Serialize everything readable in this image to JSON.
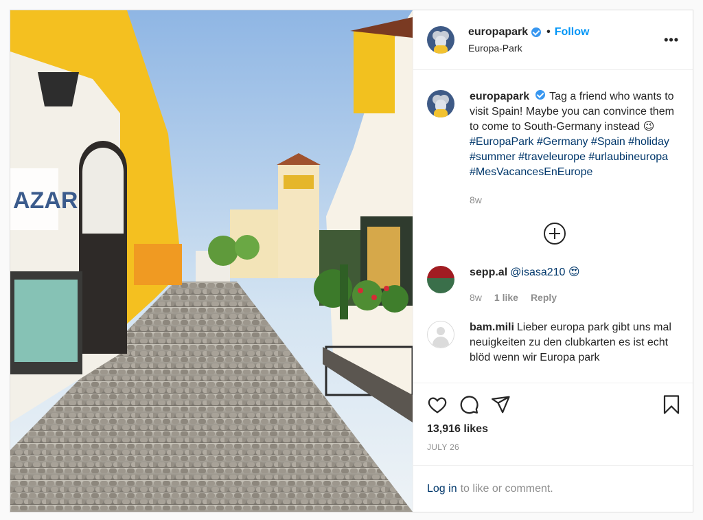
{
  "post": {
    "username": "europapark",
    "follow_label": "Follow",
    "location": "Europa-Park",
    "more_label": "•••",
    "image": {
      "shop_sign": "AZAR"
    },
    "caption": {
      "username": "europapark",
      "text": "Tag a friend who wants to visit Spain! Maybe you can convince them to come to South-Germany instead 😉 ",
      "hashtags": "#EuropaPark #Germany #Spain #holiday #summer #traveleurope #urlaubineuropa #MesVacancesEnEurope",
      "time": "8w"
    },
    "comments": [
      {
        "username": "sepp.al",
        "text": "@isasa210 😍",
        "time": "8w",
        "likes": "1 like",
        "reply_label": "Reply"
      },
      {
        "username": "bam.mili",
        "text": "Lieber europa park gibt uns mal neuigkeiten zu den clubkarten es ist echt blöd wenn wir Europa park"
      }
    ],
    "likes_count": "13,916 likes",
    "date": "JULY 26",
    "login": {
      "link_label": "Log in",
      "rest": "to like or comment."
    },
    "icons": {
      "like": "heart-icon",
      "comment": "comment-icon",
      "share": "share-icon",
      "save": "bookmark-icon",
      "more_comments": "plus-circle-icon"
    }
  }
}
